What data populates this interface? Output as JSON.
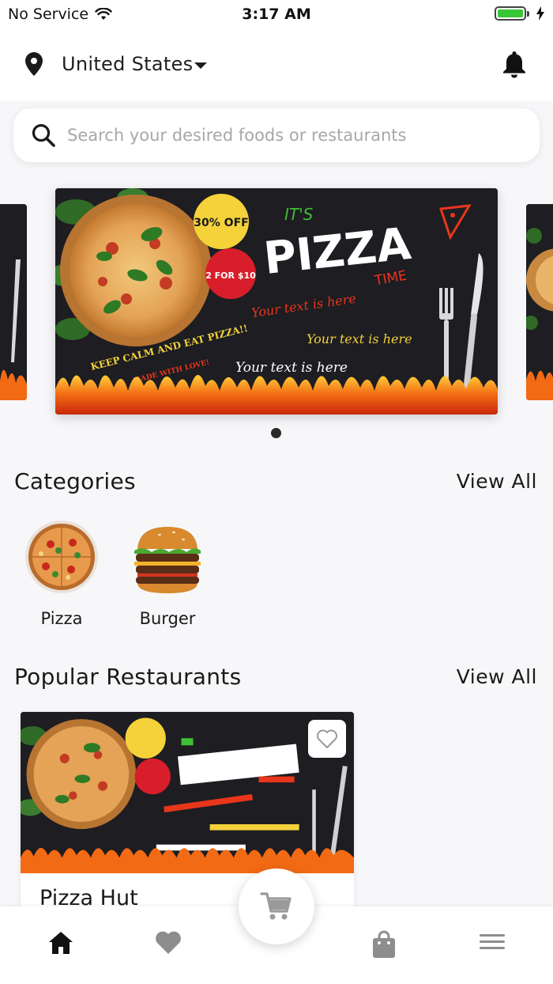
{
  "status_bar": {
    "carrier": "No Service",
    "time": "3:17 AM",
    "battery_color": "#37c837"
  },
  "header": {
    "location": "United States",
    "location_icon": "map-pin-icon",
    "notification_icon": "bell-icon"
  },
  "search": {
    "placeholder": "Search your desired foods or restaurants",
    "value": ""
  },
  "banner": {
    "badge_discount": "30% OFF",
    "badge_deal": "2 FOR $10",
    "headline_small": "IT'S",
    "headline": "PIZZA",
    "headline_sub": "TIME",
    "line1": "Your text is here",
    "line2": "Your text is here",
    "line3": "Your text is here",
    "arc_text": "KEEP CALM AND EAT PIZZA!!",
    "arc_sub": "MADE WITH LOVE!",
    "page_count": 1,
    "active_page": 1
  },
  "categories": {
    "title": "Categories",
    "view_all": "View All",
    "items": [
      {
        "label": "Pizza",
        "icon": "pizza-image"
      },
      {
        "label": "Burger",
        "icon": "burger-image"
      }
    ]
  },
  "popular": {
    "title": "Popular Restaurants",
    "view_all": "View All",
    "items": [
      {
        "name": "Pizza Hut",
        "favorite": false
      }
    ]
  },
  "bottom_nav": {
    "items": [
      "home-icon",
      "heart-icon",
      "cart-icon",
      "bag-icon",
      "menu-icon"
    ],
    "active": "home-icon"
  },
  "colors": {
    "accent": "#e8361b",
    "text": "#1a1a1a",
    "placeholder": "#a8a8a8",
    "background": "#f7f7f9"
  }
}
